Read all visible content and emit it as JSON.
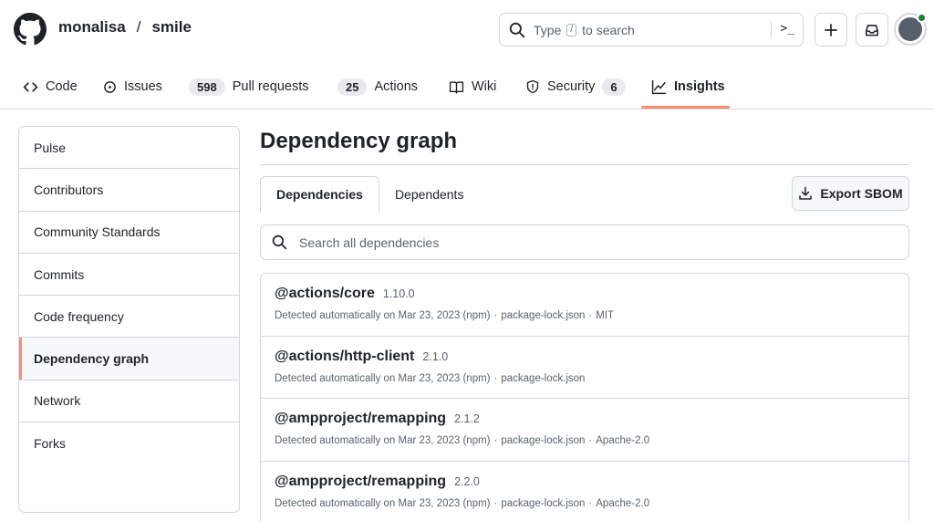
{
  "header": {
    "owner": "monalisa",
    "separator": "/",
    "repo": "smile",
    "search": {
      "prefix": "Type",
      "key": "/",
      "suffix": "to search"
    },
    "command_palette": ">_"
  },
  "tabs": [
    {
      "label": "Code",
      "icon": "code-icon"
    },
    {
      "label": "Issues",
      "icon": "issue-icon"
    },
    {
      "label": "Pull requests",
      "count": "598",
      "icon": "none"
    },
    {
      "label": "Actions",
      "count": "25",
      "icon": "none"
    },
    {
      "label": "Wiki",
      "icon": "book-icon"
    },
    {
      "label": "Security",
      "count": "6",
      "icon": "shield-icon"
    },
    {
      "label": "Insights",
      "icon": "graph-icon",
      "active": true
    }
  ],
  "sidebar": {
    "items": [
      {
        "label": "Pulse"
      },
      {
        "label": "Contributors"
      },
      {
        "label": "Community Standards"
      },
      {
        "label": "Commits"
      },
      {
        "label": "Code frequency"
      },
      {
        "label": "Dependency graph",
        "active": true
      },
      {
        "label": "Network"
      },
      {
        "label": "Forks"
      }
    ]
  },
  "main": {
    "title": "Dependency graph",
    "subtabs": [
      {
        "label": "Dependencies",
        "active": true
      },
      {
        "label": "Dependents"
      }
    ],
    "export_label": "Export SBOM",
    "search_placeholder": "Search all dependencies",
    "dependencies": [
      {
        "name": "@actions/core",
        "version": "1.10.0",
        "detected": "Detected automatically on Mar 23, 2023 (npm)",
        "file": "package-lock.json",
        "license": "MIT"
      },
      {
        "name": "@actions/http-client",
        "version": "2.1.0",
        "detected": "Detected automatically on Mar 23, 2023 (npm)",
        "file": "package-lock.json",
        "license": ""
      },
      {
        "name": "@ampproject/remapping",
        "version": "2.1.2",
        "detected": "Detected automatically on Mar 23, 2023 (npm)",
        "file": "package-lock.json",
        "license": "Apache-2.0"
      },
      {
        "name": "@ampproject/remapping",
        "version": "2.2.0",
        "detected": "Detected automatically on Mar 23, 2023 (npm)",
        "file": "package-lock.json",
        "license": "Apache-2.0"
      }
    ]
  },
  "colors": {
    "accent_underline": "#fd8c73",
    "status_dot": "#1a7f37",
    "border": "#d0d7de",
    "muted_text": "#59636e"
  }
}
